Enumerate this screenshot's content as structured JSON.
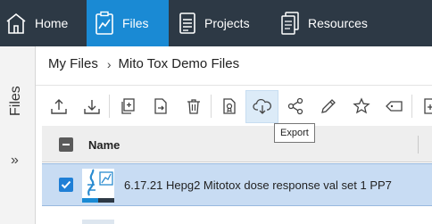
{
  "nav": {
    "items": [
      {
        "label": "Home",
        "icon": "home-icon"
      },
      {
        "label": "Files",
        "icon": "files-chart-icon"
      },
      {
        "label": "Projects",
        "icon": "projects-icon"
      },
      {
        "label": "Resources",
        "icon": "resources-icon"
      }
    ],
    "active": "Files"
  },
  "rail": {
    "label": "Files",
    "expand_glyph": "»"
  },
  "breadcrumb": {
    "root": "My Files",
    "separator": "›",
    "current": "Mito Tox Demo Files"
  },
  "toolbar": {
    "buttons": [
      {
        "icon": "upload-icon",
        "group": 1
      },
      {
        "icon": "download-icon",
        "group": 1
      },
      {
        "icon": "copy-icon",
        "group": 2
      },
      {
        "icon": "move-icon",
        "group": 2
      },
      {
        "icon": "delete-icon",
        "group": 2
      },
      {
        "icon": "certificate-icon",
        "group": 3
      },
      {
        "icon": "export-icon",
        "group": 3,
        "active": true
      },
      {
        "icon": "share-icon",
        "group": 3
      },
      {
        "icon": "rename-icon",
        "group": 3
      },
      {
        "icon": "star-icon",
        "group": 3
      },
      {
        "icon": "tag-icon",
        "group": 3
      },
      {
        "icon": "add-icon",
        "group": 4
      }
    ],
    "tooltip": "Export"
  },
  "table": {
    "column_header": "Name",
    "rows": [
      {
        "name": "6.17.21 Hepg2 Mitotox dose response val set 1 PP7",
        "selected": true,
        "icon": "dose-response-file-icon"
      }
    ]
  },
  "colors": {
    "nav_bg": "#2d3945",
    "nav_active": "#1a8ad4",
    "selection": "#c8dcf3",
    "checkbox": "#1f7fd6"
  }
}
